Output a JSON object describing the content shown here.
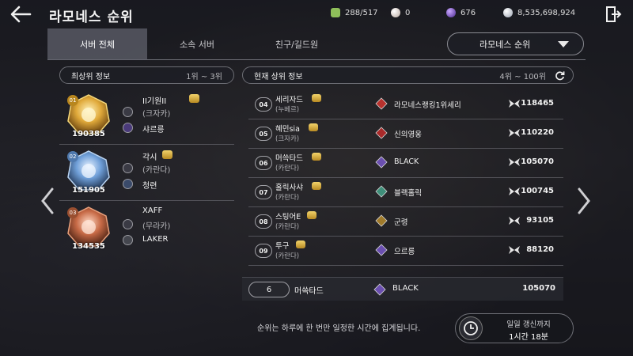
{
  "header": {
    "title": "라모네스 순위",
    "resources": [
      {
        "icon": "energy-icon",
        "value": "288/517",
        "color": "#8fbf5a"
      },
      {
        "icon": "pearl-icon",
        "value": "0",
        "color": "#d9c9c0"
      },
      {
        "icon": "dark-crystal-icon",
        "value": "676",
        "color": "#8a5fd0"
      },
      {
        "icon": "silver-coin-icon",
        "value": "8,535,698,924",
        "color": "#d8dde6"
      }
    ]
  },
  "tabs": [
    {
      "label": "서버 전체",
      "active": true
    },
    {
      "label": "소속 서버",
      "active": false
    },
    {
      "label": "친구/길드원",
      "active": false
    }
  ],
  "ranking_select": {
    "label": "라모네스 순위"
  },
  "top_panel": {
    "label": "최상위 정보",
    "range": "1위 ~ 3위",
    "entries": [
      {
        "rank": "01",
        "score": "190385",
        "name": "II기원II",
        "server": "(크자카)",
        "guild": "샤르릉",
        "color": "#e0a93a"
      },
      {
        "rank": "02",
        "score": "151905",
        "name": "각시",
        "server": "(카란다)",
        "guild": "청련",
        "color": "#6f9fd8"
      },
      {
        "rank": "03",
        "score": "134535",
        "name": "XAFF",
        "server": "(무라카)",
        "guild": "LAKER",
        "color": "#c76a46"
      }
    ]
  },
  "current_panel": {
    "label": "현재 상위 정보",
    "range": "4위 ~ 100위",
    "rows": [
      {
        "rank": "04",
        "name": "세리자드",
        "server": "(누베르)",
        "guild": "라모네스랭킹1위세리",
        "score": "118465",
        "crest_color": "#b8322e"
      },
      {
        "rank": "05",
        "name": "혜민sia",
        "server": "(크자카)",
        "guild": "신의영웅",
        "score": "110220",
        "crest_color": "#a82a2a"
      },
      {
        "rank": "06",
        "name": "머쓱타드",
        "server": "(카란다)",
        "guild": "BLACK",
        "score": "105070",
        "crest_color": "#6b4fb0"
      },
      {
        "rank": "07",
        "name": "홀릭사샤",
        "server": "(카란다)",
        "guild": "블랙홀릭",
        "score": "100745",
        "crest_color": "#3f8f7a"
      },
      {
        "rank": "08",
        "name": "스팅어E",
        "server": "(카란다)",
        "guild": "군령",
        "score": "93105",
        "crest_color": "#a07a2a"
      },
      {
        "rank": "09",
        "name": "투구",
        "server": "(카란다)",
        "guild": "으르릉",
        "score": "88120",
        "crest_color": "#6b4fb0"
      }
    ]
  },
  "my_rank": {
    "rank": "6",
    "name": "머쓱타드",
    "guild": "BLACK",
    "score": "105070"
  },
  "notice": "순위는 하루에 한 번만 일정한 시간에 집계됩니다.",
  "timer": {
    "label": "일일 갱신까지",
    "value": "1시간 18분"
  }
}
